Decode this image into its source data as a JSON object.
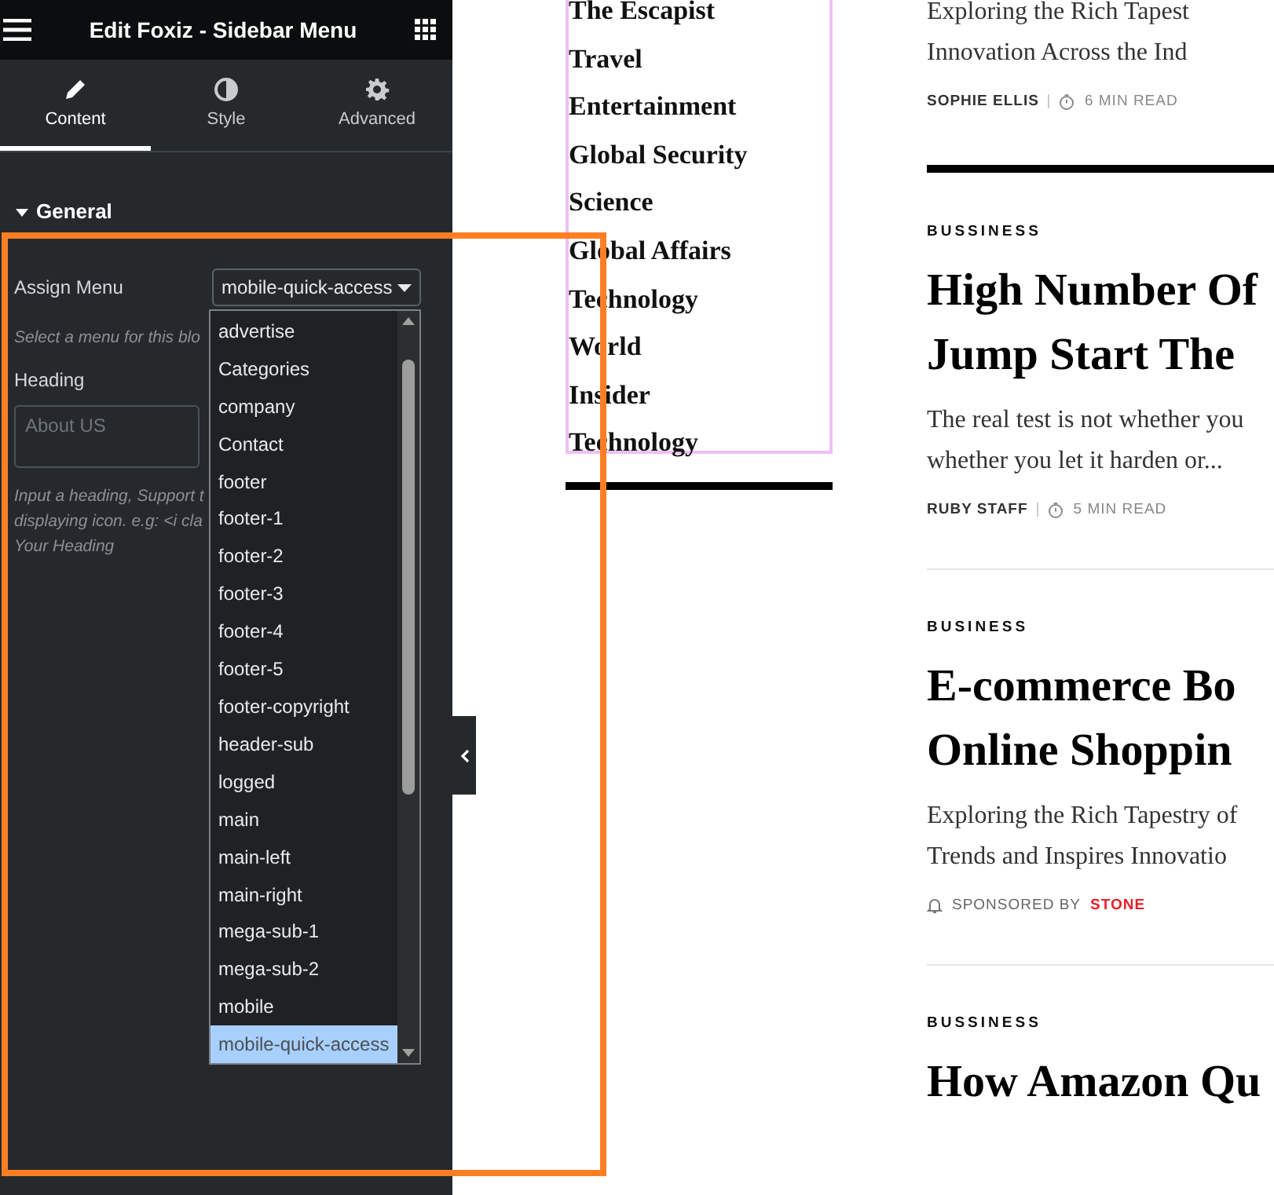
{
  "editor": {
    "title": "Edit Foxiz - Sidebar Menu",
    "tabs": [
      {
        "label": "Content",
        "selected": true
      },
      {
        "label": "Style",
        "selected": false
      },
      {
        "label": "Advanced",
        "selected": false
      }
    ],
    "section": {
      "title": "General",
      "expanded": true
    },
    "assign_menu": {
      "label": "Assign Menu",
      "value": "mobile-quick-access",
      "help": "Select a menu for this blo"
    },
    "heading": {
      "label": "Heading",
      "placeholder": "About US",
      "help": [
        "Input a heading, Support t",
        "displaying icon. e.g: <i cla",
        "Your Heading"
      ]
    },
    "dropdown": {
      "options": [
        {
          "label": "advertise",
          "selected": false
        },
        {
          "label": "Categories",
          "selected": false
        },
        {
          "label": "company",
          "selected": false
        },
        {
          "label": "Contact",
          "selected": false
        },
        {
          "label": "footer",
          "selected": false
        },
        {
          "label": "footer-1",
          "selected": false
        },
        {
          "label": "footer-2",
          "selected": false
        },
        {
          "label": "footer-3",
          "selected": false
        },
        {
          "label": "footer-4",
          "selected": false
        },
        {
          "label": "footer-5",
          "selected": false
        },
        {
          "label": "footer-copyright",
          "selected": false
        },
        {
          "label": "header-sub",
          "selected": false
        },
        {
          "label": "logged",
          "selected": false
        },
        {
          "label": "main",
          "selected": false
        },
        {
          "label": "main-left",
          "selected": false
        },
        {
          "label": "main-right",
          "selected": false
        },
        {
          "label": "mega-sub-1",
          "selected": false
        },
        {
          "label": "mega-sub-2",
          "selected": false
        },
        {
          "label": "mobile",
          "selected": false
        },
        {
          "label": "mobile-quick-access",
          "selected": true
        }
      ]
    }
  },
  "canvas": {
    "menu_items": [
      "The Escapist",
      "Travel",
      "Entertainment",
      "Global Security",
      "Science",
      "Global Affairs",
      "Technology",
      "World",
      "Insider",
      "Technology"
    ],
    "articles": [
      {
        "excerpt_lines": [
          "Exploring the Rich Tapest",
          "Innovation Across the Ind"
        ],
        "meta": {
          "kind": "author",
          "author": "SOPHIE ELLIS",
          "read_time": "6 MIN READ"
        }
      },
      {
        "category": "BUSSINESS",
        "title_lines": [
          "High Number Of",
          "Jump Start The"
        ],
        "excerpt_lines": [
          "The real test is not whether you",
          "whether you let it harden or..."
        ],
        "meta": {
          "kind": "author",
          "author": "RUBY STAFF",
          "read_time": "5 MIN READ"
        }
      },
      {
        "category": "BUSINESS",
        "title_lines": [
          "E-commerce Bo",
          "Online Shoppin"
        ],
        "excerpt_lines": [
          "Exploring the Rich Tapestry of",
          "Trends and Inspires Innovatio"
        ],
        "meta": {
          "kind": "sponsored",
          "label": "SPONSORED BY",
          "sponsor": "STONE"
        }
      },
      {
        "category": "BUSSINESS",
        "title_lines": [
          "How Amazon Qu"
        ]
      }
    ]
  }
}
